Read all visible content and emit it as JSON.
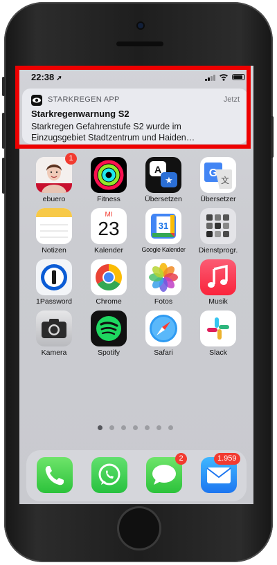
{
  "status_bar": {
    "time": "22:38",
    "location_glyph": "➚"
  },
  "notification": {
    "app": "STARKREGEN APP",
    "time": "Jetzt",
    "title": "Starkregenwarnung S2",
    "body_line1": "Starkregen Gefahrenstufe S2 wurde im",
    "body_line2": "Einzugsgebiet  Stadtzentrum und Haiden…"
  },
  "apps": [
    {
      "label": "ebuero",
      "icon": "ebuero-icon",
      "badge": "1"
    },
    {
      "label": "Fitness",
      "icon": "fitness-rings-icon"
    },
    {
      "label": "Übersetzen",
      "icon": "translate-icon"
    },
    {
      "label": "Übersetzer",
      "icon": "google-translate-icon"
    },
    {
      "label": "Notizen",
      "icon": "notes-icon"
    },
    {
      "label": "Kalender",
      "icon": "calendar-icon",
      "day": "MI",
      "date": "23"
    },
    {
      "label": "Google Kalender",
      "icon": "google-calendar-icon",
      "date": "31"
    },
    {
      "label": "Dienstprogr.",
      "icon": "utilities-folder-icon"
    },
    {
      "label": "1Password",
      "icon": "onepassword-icon"
    },
    {
      "label": "Chrome",
      "icon": "chrome-icon"
    },
    {
      "label": "Fotos",
      "icon": "photos-icon"
    },
    {
      "label": "Musik",
      "icon": "music-icon"
    },
    {
      "label": "Kamera",
      "icon": "camera-icon"
    },
    {
      "label": "Spotify",
      "icon": "spotify-icon"
    },
    {
      "label": "Safari",
      "icon": "safari-icon"
    },
    {
      "label": "Slack",
      "icon": "slack-icon"
    }
  ],
  "page_dots": {
    "count": 7,
    "active": 1
  },
  "dock": [
    {
      "icon": "phone-icon"
    },
    {
      "icon": "whatsapp-icon"
    },
    {
      "icon": "messages-icon",
      "badge": "2"
    },
    {
      "icon": "mail-icon",
      "badge": "1.959"
    }
  ],
  "colors": {
    "highlight": "#ee0000",
    "badge": "#f23b30"
  }
}
